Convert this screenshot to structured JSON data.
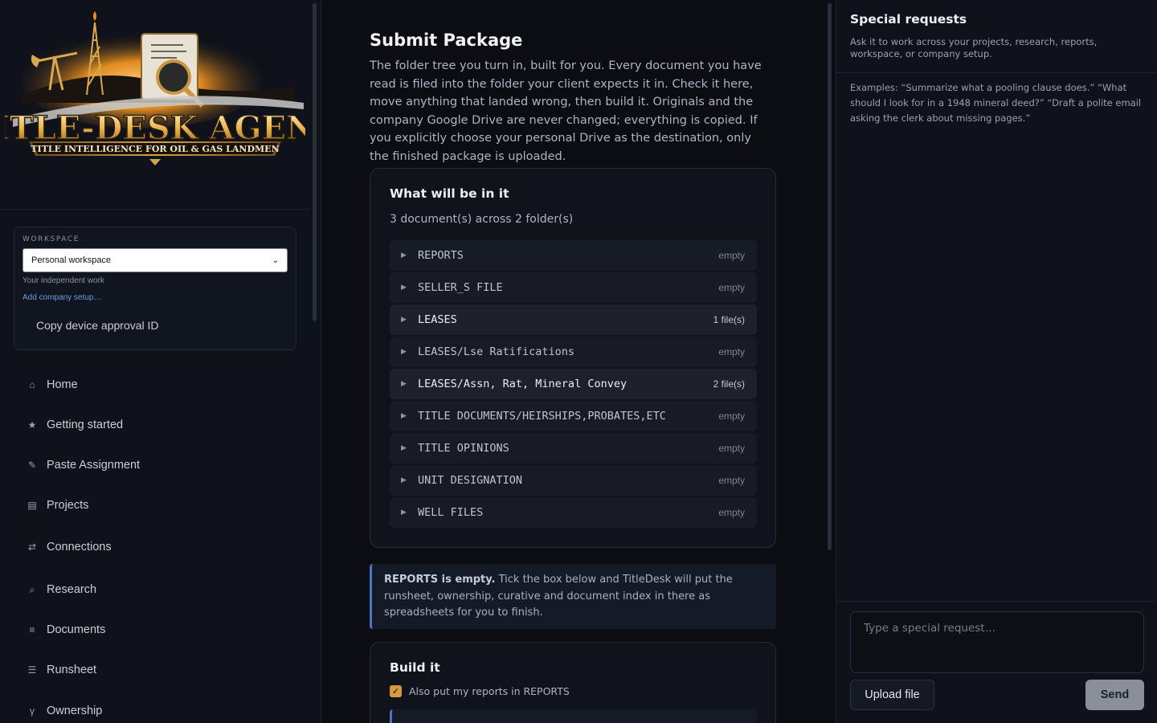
{
  "logo": {
    "title": "TITLE-DESK AGENT",
    "tagline": "TITLE INTELLIGENCE FOR OIL & GAS LANDMEN"
  },
  "workspace": {
    "label": "WORKSPACE",
    "selected": "Personal workspace",
    "subtitle": "Your independent work",
    "add_link": "Add company setup…",
    "copy_label": "Copy device approval ID"
  },
  "nav": {
    "items": [
      {
        "label": "Home",
        "icon": "home-icon",
        "glyph": "⌂"
      },
      {
        "label": "Getting started",
        "icon": "star-icon",
        "glyph": "★"
      },
      {
        "label": "Paste Assignment",
        "icon": "pencil-icon",
        "glyph": "✎"
      },
      {
        "label": "Projects",
        "icon": "folder-icon",
        "glyph": "▤"
      },
      {
        "label": "Connections",
        "icon": "swap-icon",
        "glyph": "⇄"
      },
      {
        "label": "Research",
        "icon": "search-icon",
        "glyph": "⌕"
      },
      {
        "label": "Documents",
        "icon": "list-icon",
        "glyph": "≡"
      },
      {
        "label": "Runsheet",
        "icon": "menu-icon",
        "glyph": "☰"
      },
      {
        "label": "Ownership",
        "icon": "branch-icon",
        "glyph": "γ"
      }
    ]
  },
  "main": {
    "title": "Submit Package",
    "description": "The folder tree you turn in, built for you. Every document you have read is filed into the folder your client expects it in. Check it here, move anything that landed wrong, then build it. Originals and the company Google Drive are never changed; everything is copied. If you explicitly choose your personal Drive as the destination, only the finished package is uploaded.",
    "contents": {
      "title": "What will be in it",
      "summary": "3 document(s) across 2 folder(s)",
      "folders": [
        {
          "name": "REPORTS",
          "count": "empty",
          "filled": false
        },
        {
          "name": "SELLER_S FILE",
          "count": "empty",
          "filled": false
        },
        {
          "name": "LEASES",
          "count": "1 file(s)",
          "filled": true
        },
        {
          "name": "LEASES/Lse Ratifications",
          "count": "empty",
          "filled": false
        },
        {
          "name": "LEASES/Assn, Rat, Mineral Convey",
          "count": "2 file(s)",
          "filled": true
        },
        {
          "name": "TITLE DOCUMENTS/HEIRSHIPS,PROBATES,ETC",
          "count": "empty",
          "filled": false
        },
        {
          "name": "TITLE OPINIONS",
          "count": "empty",
          "filled": false
        },
        {
          "name": "UNIT DESIGNATION",
          "count": "empty",
          "filled": false
        },
        {
          "name": "WELL FILES",
          "count": "empty",
          "filled": false
        }
      ]
    },
    "notice": {
      "bold": "REPORTS is empty.",
      "text": " Tick the box below and TitleDesk will put the runsheet, ownership, curative and document index in there as spreadsheets for you to finish."
    },
    "build": {
      "title": "Build it",
      "checkbox_label": "Also put my reports in REPORTS",
      "checked": true
    }
  },
  "special_requests": {
    "title": "Special requests",
    "subtitle": "Ask it to work across your projects, research, reports, workspace, or company setup.",
    "examples": "Examples: “Summarize what a pooling clause does.” “What should I look for in a 1948 mineral deed?” “Draft a polite email asking the clerk about missing pages.”",
    "input_placeholder": "Type a special request…",
    "upload_label": "Upload file",
    "send_label": "Send"
  },
  "colors": {
    "accent": "#d39a3f",
    "link": "#6e9bd8",
    "notice_border": "#4f75c4"
  }
}
